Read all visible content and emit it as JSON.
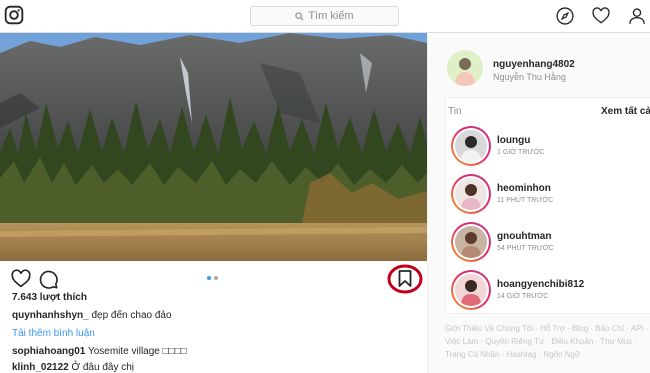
{
  "search": {
    "placeholder": "Tìm kiếm"
  },
  "post": {
    "likes": "7.643 lượt thích",
    "caption": {
      "user": "quynhanhshyn_",
      "text": "đẹp đến chao đảo"
    },
    "load_more": "Tải thêm bình luận",
    "comments": [
      {
        "user": "sophiahoang01",
        "text": "Yosemite village □□□□"
      },
      {
        "user": "klinh_02122",
        "text": "Ở đâu đây chị"
      }
    ]
  },
  "profile": {
    "username": "nguyenhang4802",
    "full_name": "Nguyễn Thu Hằng"
  },
  "stories": {
    "title": "Tin",
    "see_all": "Xem tất cả",
    "items": [
      {
        "name": "loungu",
        "time": "1 GIỜ TRƯỚC"
      },
      {
        "name": "heominhon",
        "time": "11 PHÚT TRƯỚC"
      },
      {
        "name": "gnouhtman",
        "time": "54 PHÚT TRƯỚC"
      },
      {
        "name": "hoangyenchibi812",
        "time": "14 GIỜ TRƯỚC"
      }
    ]
  },
  "footer": {
    "line1": "Giới Thiệu Về Chúng Tôi · Hỗ Trợ · Blog · Báo Chí · API ·",
    "line2": "Việc Làm · Quyền Riêng Tư · Điều Khoản · Thư Mục ·",
    "line3": "Trang Cá Nhân · Hashtag · Ngôn Ngữ"
  },
  "colors": {
    "accent": "#3897f0",
    "highlight_circle": "#c0001a"
  }
}
